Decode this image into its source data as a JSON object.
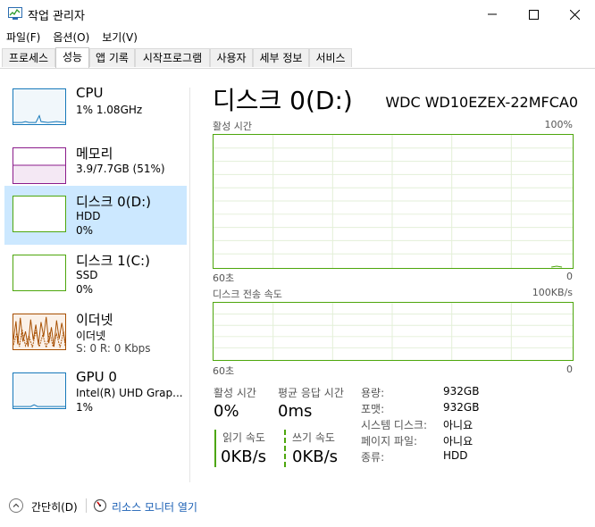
{
  "window": {
    "title": "작업 관리자"
  },
  "menu": [
    "파일(F)",
    "옵션(O)",
    "보기(V)"
  ],
  "tabs": [
    "프로세스",
    "성능",
    "앱 기록",
    "시작프로그램",
    "사용자",
    "세부 정보",
    "서비스"
  ],
  "active_tab": "성능",
  "sidebar": {
    "items": [
      {
        "title": "CPU",
        "line1": "1% 1.08GHz",
        "line2": "",
        "color": "#1779ba"
      },
      {
        "title": "메모리",
        "line1": "3.9/7.7GB (51%)",
        "line2": "",
        "color": "#8b1b8b"
      },
      {
        "title": "디스크 0(D:)",
        "line1": "HDD",
        "line2": "0%",
        "color": "#4da60c"
      },
      {
        "title": "디스크 1(C:)",
        "line1": "SSD",
        "line2": "0%",
        "color": "#4da60c"
      },
      {
        "title": "이더넷",
        "line1": "이더넷",
        "line2": "S: 0 R: 0 Kbps",
        "color": "#a74f01"
      },
      {
        "title": "GPU 0",
        "line1": "Intel(R) UHD Grap...",
        "line2": "1%",
        "color": "#1779ba"
      }
    ]
  },
  "main": {
    "title": "디스크 0(D:)",
    "model": "WDC WD10EZEX-22MFCA0",
    "graph1": {
      "label": "활성 시간",
      "max": "100%",
      "time": "60초",
      "min": "0"
    },
    "graph2": {
      "label": "디스크 전송 속도",
      "max": "100KB/s",
      "time": "60초",
      "min": "0"
    },
    "stats": {
      "active_label": "활성 시간",
      "active_value": "0%",
      "response_label": "평균 응답 시간",
      "response_value": "0ms",
      "read_label": "읽기 속도",
      "read_value": "0KB/s",
      "write_label": "쓰기 속도",
      "write_value": "0KB/s"
    },
    "properties": [
      {
        "label": "용량:",
        "value": "932GB"
      },
      {
        "label": "포맷:",
        "value": "932GB"
      },
      {
        "label": "시스템 디스크:",
        "value": "아니요"
      },
      {
        "label": "페이지 파일:",
        "value": "아니요"
      },
      {
        "label": "종류:",
        "value": "HDD"
      }
    ]
  },
  "footer": {
    "fewer_details": "간단히(D)",
    "resource_monitor": "리소스 모니터 열기"
  },
  "colors": {
    "disk": "#4da60c",
    "selected_bg": "#cce8ff"
  }
}
